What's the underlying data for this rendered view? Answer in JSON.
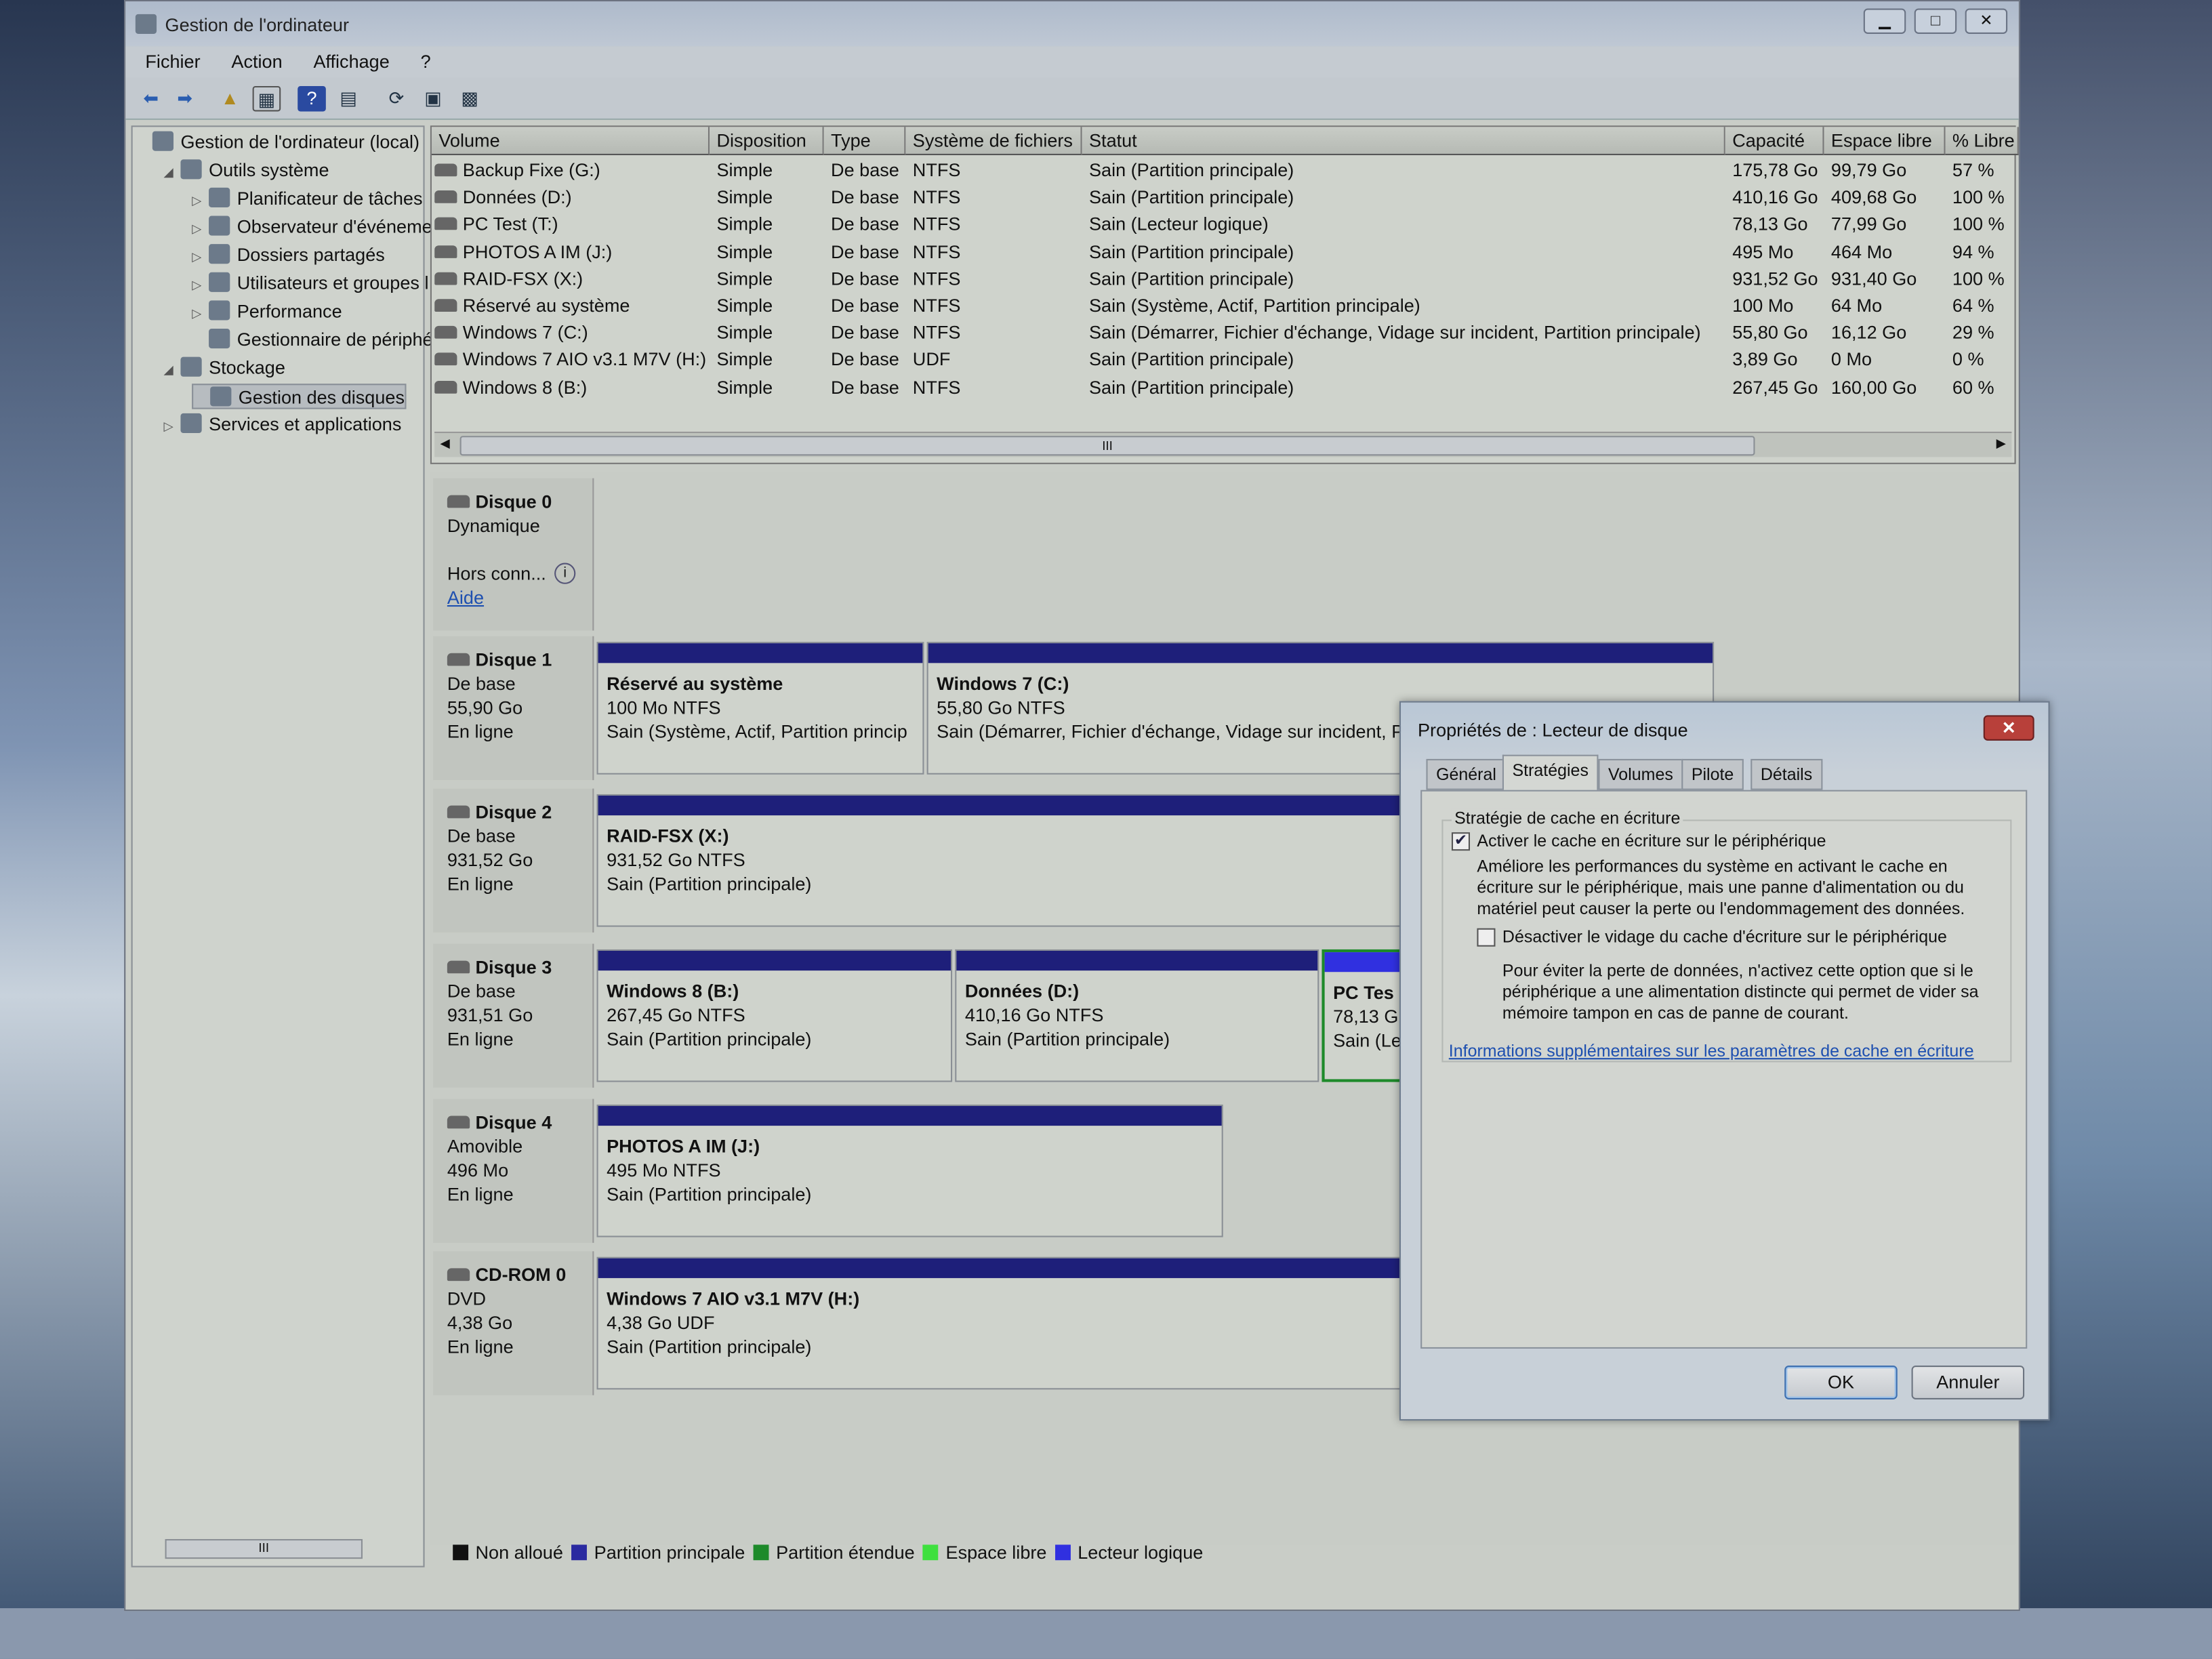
{
  "window": {
    "title": "Gestion de l'ordinateur",
    "controls": [
      "minimize",
      "maximize",
      "close"
    ]
  },
  "menu": [
    "Fichier",
    "Action",
    "Affichage",
    "?"
  ],
  "toolbar": [
    "back-icon",
    "forward-icon",
    "up-folder-icon",
    "show-hide-tree-icon",
    "help-icon",
    "properties-view-icon",
    "refresh-icon",
    "export-icon",
    "settings-icon"
  ],
  "tree": [
    {
      "label": "Gestion de l'ordinateur (local)",
      "level": 0,
      "expander": ""
    },
    {
      "label": "Outils système",
      "level": 1,
      "expander": "◢"
    },
    {
      "label": "Planificateur de tâches",
      "level": 2,
      "expander": "▷"
    },
    {
      "label": "Observateur d'événeme",
      "level": 2,
      "expander": "▷"
    },
    {
      "label": "Dossiers partagés",
      "level": 2,
      "expander": "▷"
    },
    {
      "label": "Utilisateurs et groupes l",
      "level": 2,
      "expander": "▷"
    },
    {
      "label": "Performance",
      "level": 2,
      "expander": "▷"
    },
    {
      "label": "Gestionnaire de périphé",
      "level": 2,
      "expander": ""
    },
    {
      "label": "Stockage",
      "level": 1,
      "expander": "◢"
    },
    {
      "label": "Gestion des disques",
      "level": 2,
      "expander": "",
      "selected": true
    },
    {
      "label": "Services et applications",
      "level": 1,
      "expander": "▷"
    }
  ],
  "volumes": {
    "columns": [
      "Volume",
      "Disposition",
      "Type",
      "Système de fichiers",
      "Statut",
      "Capacité",
      "Espace libre",
      "% Libre"
    ],
    "rows": [
      [
        "Backup Fixe (G:)",
        "Simple",
        "De base",
        "NTFS",
        "Sain (Partition principale)",
        "175,78 Go",
        "99,79 Go",
        "57 %"
      ],
      [
        "Données (D:)",
        "Simple",
        "De base",
        "NTFS",
        "Sain (Partition principale)",
        "410,16 Go",
        "409,68 Go",
        "100 %"
      ],
      [
        "PC Test (T:)",
        "Simple",
        "De base",
        "NTFS",
        "Sain (Lecteur logique)",
        "78,13 Go",
        "77,99 Go",
        "100 %"
      ],
      [
        "PHOTOS A IM (J:)",
        "Simple",
        "De base",
        "NTFS",
        "Sain (Partition principale)",
        "495 Mo",
        "464 Mo",
        "94 %"
      ],
      [
        "RAID-FSX (X:)",
        "Simple",
        "De base",
        "NTFS",
        "Sain (Partition principale)",
        "931,52 Go",
        "931,40 Go",
        "100 %"
      ],
      [
        "Réservé au système",
        "Simple",
        "De base",
        "NTFS",
        "Sain (Système, Actif, Partition principale)",
        "100 Mo",
        "64 Mo",
        "64 %"
      ],
      [
        "Windows 7 (C:)",
        "Simple",
        "De base",
        "NTFS",
        "Sain (Démarrer, Fichier d'échange, Vidage sur incident, Partition principale)",
        "55,80 Go",
        "16,12 Go",
        "29 %"
      ],
      [
        "Windows 7 AIO v3.1 M7V (H:)",
        "Simple",
        "De base",
        "UDF",
        "Sain (Partition principale)",
        "3,89 Go",
        "0 Mo",
        "0 %"
      ],
      [
        "Windows 8 (B:)",
        "Simple",
        "De base",
        "NTFS",
        "Sain (Partition principale)",
        "267,45 Go",
        "160,00 Go",
        "60 %"
      ]
    ],
    "scroll_thumb": "III"
  },
  "disks": [
    {
      "name": "Disque 0",
      "lines": [
        "Dynamique",
        "",
        "Hors conn..."
      ],
      "link": "Aide",
      "partitions": []
    },
    {
      "name": "Disque 1",
      "lines": [
        "De base",
        "55,90 Go",
        "En ligne"
      ],
      "partitions": [
        {
          "name": "Réservé au système",
          "size": "100 Mo NTFS",
          "status": "Sain (Système, Actif, Partition princip"
        },
        {
          "name": "Windows 7  (C:)",
          "size": "55,80 Go NTFS",
          "status": "Sain (Démarrer, Fichier d'échange, Vidage sur incident, P"
        }
      ]
    },
    {
      "name": "Disque 2",
      "lines": [
        "De base",
        "931,52 Go",
        "En ligne"
      ],
      "partitions": [
        {
          "name": "RAID-FSX  (X:)",
          "size": "931,52 Go NTFS",
          "status": "Sain (Partition principale)"
        }
      ]
    },
    {
      "name": "Disque 3",
      "lines": [
        "De base",
        "931,51 Go",
        "En ligne"
      ],
      "partitions": [
        {
          "name": "Windows 8  (B:)",
          "size": "267,45 Go NTFS",
          "status": "Sain (Partition principale)"
        },
        {
          "name": "Données  (D:)",
          "size": "410,16 Go NTFS",
          "status": "Sain (Partition principale)"
        },
        {
          "name": "PC Tes",
          "size": "78,13 G",
          "status": "Sain (Le"
        }
      ]
    },
    {
      "name": "Disque 4",
      "lines": [
        "Amovible",
        "496 Mo",
        "En ligne"
      ],
      "partitions": [
        {
          "name": "PHOTOS A IM  (J:)",
          "size": "495 Mo NTFS",
          "status": "Sain (Partition principale)"
        }
      ]
    },
    {
      "name": "CD-ROM 0",
      "lines": [
        "DVD",
        "4,38 Go",
        "En ligne"
      ],
      "partitions": [
        {
          "name": "Windows 7 AIO v3.1 M7V  (H:)",
          "size": "4,38 Go UDF",
          "status": "Sain (Partition principale)"
        }
      ]
    }
  ],
  "legend": [
    {
      "label": "Non alloué",
      "color": "#111111"
    },
    {
      "label": "Partition principale",
      "color": "#2a2aa0"
    },
    {
      "label": "Partition étendue",
      "color": "#1d8a2a"
    },
    {
      "label": "Espace libre",
      "color": "#3ee03e"
    },
    {
      "label": "Lecteur logique",
      "color": "#3030e0"
    }
  ],
  "dialog": {
    "title": "Propriétés de : Lecteur de disque",
    "tabs": [
      "Général",
      "Stratégies",
      "Volumes",
      "Pilote",
      "Détails"
    ],
    "active_tab": "Stratégies",
    "group_label": "Stratégie de cache en écriture",
    "option1": {
      "label": "Activer le cache en écriture sur le périphérique",
      "checked": true,
      "description": "Améliore les performances du système en activant le cache en écriture sur le périphérique, mais une panne d'alimentation ou du matériel peut causer la perte ou l'endommagement des données."
    },
    "option2": {
      "label": "Désactiver le vidage du cache d'écriture sur le périphérique",
      "checked": false,
      "description": "Pour éviter la perte de données, n'activez cette option que si le périphérique a une alimentation distincte qui permet de vider sa mémoire tampon en cas de panne de courant."
    },
    "link": "Informations supplémentaires sur les paramètres de cache en écriture",
    "ok": "OK",
    "cancel": "Annuler"
  }
}
